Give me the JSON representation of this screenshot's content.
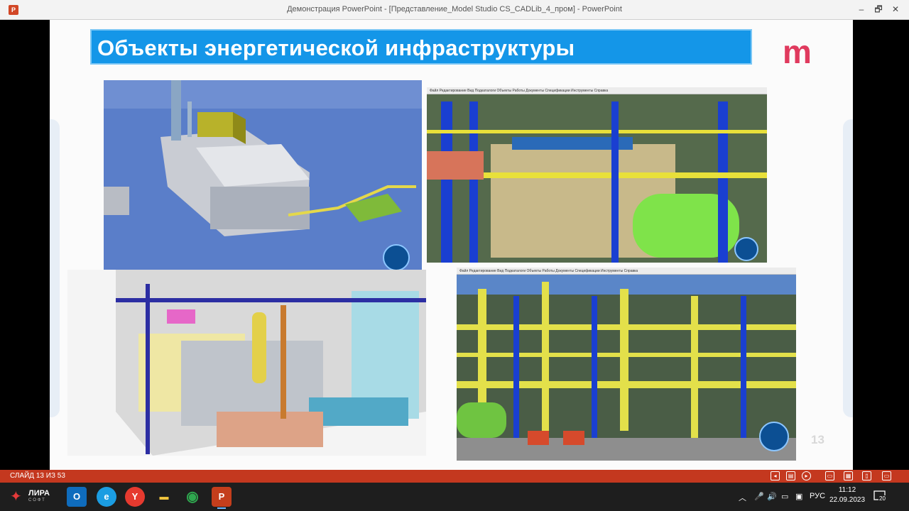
{
  "window": {
    "app_icon": "P",
    "title": "Демонстрация PowerPoint - [Представление_Model Studio CS_CADLib_4_пром] - PowerPoint",
    "controls": [
      "–",
      "🗗",
      "✕"
    ]
  },
  "slide": {
    "title": "Объекты энергетической инфраструктуры",
    "logo": "m",
    "page_number": "13",
    "images": [
      {
        "name": "power-plant-aerial-model",
        "menu": ""
      },
      {
        "name": "boiler-room-model",
        "menu": "Файл   Редактирование   Вид   Подкаталоги   Объекты   Работы   Документы   Спецификации   Инструменты   Справка"
      },
      {
        "name": "turbine-hall-model",
        "menu": ""
      },
      {
        "name": "pipe-rack-model",
        "menu": "Файл   Редактирование   Вид   Подкаталоги   Объекты   Работы   Документы   Спецификации   Инструменты   Справка"
      }
    ]
  },
  "statusbar": {
    "slide_counter": "СЛАЙД 13 ИЗ 53",
    "icons": [
      "previous-icon",
      "slide-menu-icon",
      "next-icon",
      "normal-view-icon",
      "slide-sorter-icon",
      "reading-view-icon",
      "slideshow-icon"
    ]
  },
  "taskbar": {
    "start_label": "ЛИРА",
    "start_sub": "СОФТ",
    "apps": [
      {
        "name": "outlook-app",
        "glyph": "O",
        "color": "#0f6cbd"
      },
      {
        "name": "edge-app",
        "glyph": "e",
        "color": "#1b9de2"
      },
      {
        "name": "yandex-browser-app",
        "glyph": "Y",
        "color": "#e63a2f"
      },
      {
        "name": "file-explorer-app",
        "glyph": "▬",
        "color": "#f2c53d"
      },
      {
        "name": "chrome-app",
        "glyph": "◉",
        "color": "#2fa84f"
      },
      {
        "name": "powerpoint-app",
        "glyph": "P",
        "color": "#c43e1c"
      }
    ],
    "tray": {
      "chevron": "︿",
      "language": "РУС"
    },
    "time": "11:12",
    "date": "22.09.2023",
    "notifications": "20"
  }
}
